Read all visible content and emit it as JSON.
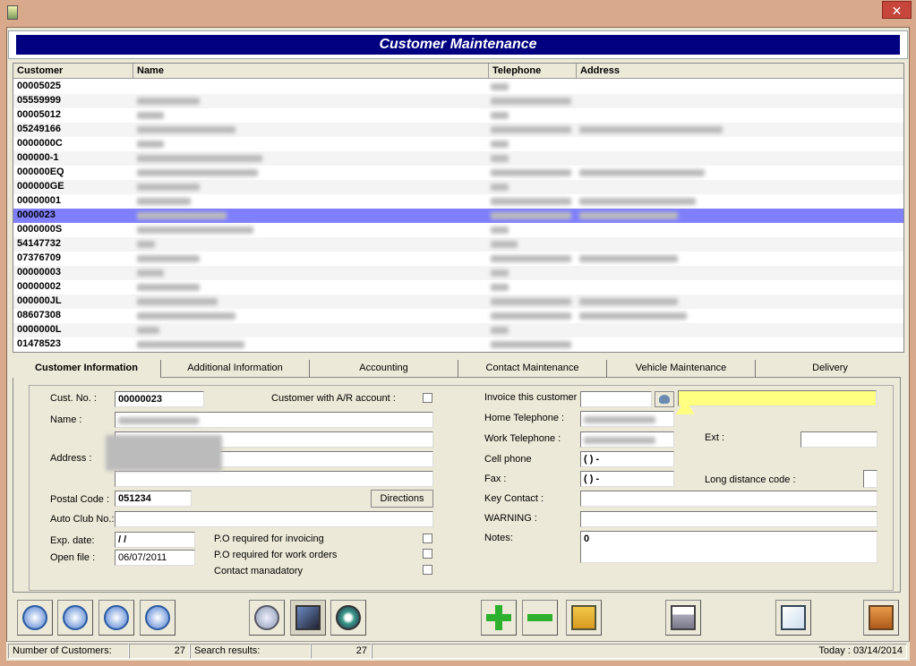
{
  "window": {
    "close_glyph": "✕"
  },
  "header": {
    "title": "Customer Maintenance"
  },
  "grid": {
    "columns": [
      "Customer",
      "Name",
      "Telephone",
      "Address"
    ],
    "rows": [
      "00005025",
      "05559999",
      "00005012",
      "05249166",
      "0000000C",
      "000000-1",
      "000000EQ",
      "000000GE",
      "00000001",
      "0000023",
      "0000000S",
      "54147732",
      "07376709",
      "00000003",
      "00000002",
      "000000JL",
      "08607308",
      "0000000L",
      "01478523"
    ],
    "selected_index": 9
  },
  "tabs": [
    "Customer Information",
    "Additional Information",
    "Accounting",
    "Contact Maintenance",
    "Vehicle Maintenance",
    "Delivery"
  ],
  "form": {
    "cust_no_label": "Cust. No. :",
    "cust_no_value": "00000023",
    "ar_label": "Customer with A/R account :",
    "name_label": "Name :",
    "address_label": "Address :",
    "postal_label": "Postal Code :",
    "postal_value": "051234",
    "directions_label": "Directions",
    "autoclub_label": "Auto Club No.:",
    "exp_label": "Exp. date:",
    "exp_value": " /  /",
    "open_label": "Open file :",
    "open_value": "06/07/2011",
    "po_invoice_label": "P.O required for invoicing",
    "po_work_label": "P.O required for work orders",
    "contact_mand_label": "Contact manadatory",
    "invoice_label": "Invoice this customer",
    "home_tel_label": "Home Telephone :",
    "work_tel_label": "Work Telephone :",
    "ext_label": "Ext :",
    "cell_label": "Cell phone",
    "cell_value": "(   )   -",
    "fax_label": "Fax :",
    "fax_value": "(   )   -",
    "long_dist_label": "Long distance code :",
    "key_contact_label": "Key Contact :",
    "warning_label": "WARNING :",
    "notes_label": "Notes:",
    "notes_value": "0"
  },
  "toolbar": {
    "icons": [
      "nav-first-icon",
      "nav-prev-icon",
      "nav-next-icon",
      "nav-last-icon",
      "search-icon",
      "view-icon",
      "preview-icon",
      "add-icon",
      "remove-icon",
      "save-icon",
      "print-icon",
      "spellcheck-icon",
      "exit-icon"
    ]
  },
  "status": {
    "count_label": "Number of Customers:",
    "count_value": "27",
    "search_label": "Search results:",
    "search_value": "27",
    "today": "Today : 03/14/2014"
  },
  "colors": {
    "header_bg": "#000080",
    "selected_row": "#8080ff",
    "highlight_field": "#ffff80"
  }
}
